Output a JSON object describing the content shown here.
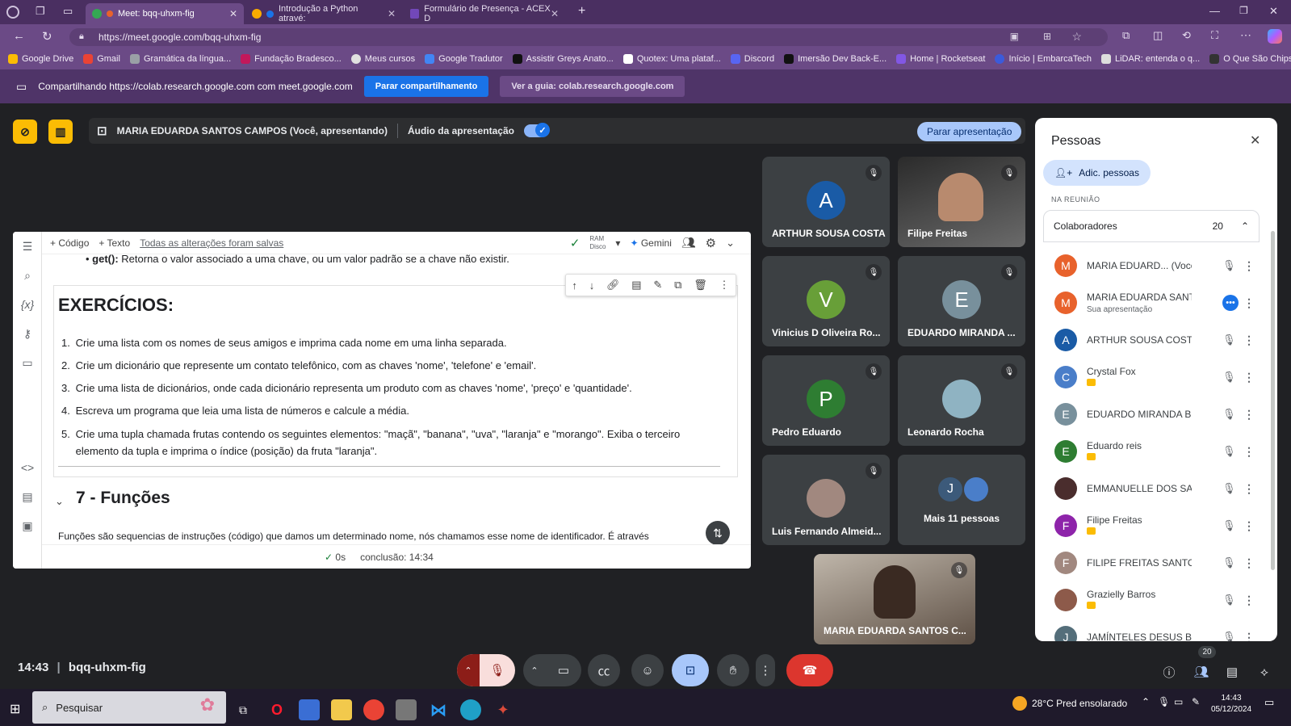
{
  "tabs": [
    {
      "title": "Meet: bqq-uhxm-fig",
      "active": true
    },
    {
      "title": "Introdução a Python atravé:",
      "active": false
    },
    {
      "title": "Formulário de Presença - ACEX D",
      "active": false
    }
  ],
  "address": {
    "url": "https://meet.google.com/bqq-uhxm-fig"
  },
  "bookmarks": [
    "Google Drive",
    "Gmail",
    "Gramática da língua...",
    "Fundação Bradesco...",
    "Meus cursos",
    "Google Tradutor",
    "Assistir Greys Anato...",
    "Quotex: Uma plataf...",
    "Discord",
    "Imersão Dev Back-E...",
    "Home | Rocketseat",
    "Início | EmbarcaTech",
    "LiDAR: entenda o q...",
    "O Que São Chips de..."
  ],
  "sharing": {
    "message": "Compartilhando https://colab.research.google.com com meet.google.com",
    "stop_label": "Parar compartilhamento",
    "view_label": "Ver a guia: colab.research.google.com"
  },
  "presentation": {
    "presenter": "MARIA EDUARDA SANTOS CAMPOS (Você, apresentando)",
    "audio_label": "Áudio da apresentação",
    "stop_label": "Parar apresentação"
  },
  "colab": {
    "add_code": "+ Código",
    "add_text": "+ Texto",
    "saved": "Todas as alterações foram salvas",
    "ram": "RAM",
    "disk": "Disco",
    "gemini": "Gemini",
    "get_bold": "get():",
    "get_text": " Retorna o valor associado a uma chave, ou um valor padrão se a chave não existir.",
    "exercises_title": "EXERCÍCIOS:",
    "exercises": [
      "Crie uma lista com os nomes de seus amigos e imprima cada nome em uma linha separada.",
      "Crie um dicionário que represente um contato telefônico, com as chaves 'nome', 'telefone' e 'email'.",
      "Crie uma lista de dicionários, onde cada dicionário representa um produto com as chaves 'nome', 'preço' e 'quantidade'.",
      "Escreva um programa que leia uma lista de números e calcule a média.",
      "Crie uma tupla chamada frutas contendo os seguintes elementos: \"maçã\", \"banana\", \"uva\", \"laranja\" e \"morango\". Exiba o terceiro elemento da tupla e imprima o índice (posição) da fruta \"laranja\"."
    ],
    "section_title": "7 - Funções",
    "cut_text": "Funções são sequencias de instruções (código) que damos um determinado nome, nós chamamos esse nome de identificador. É através",
    "status_time": "0s",
    "status_done": "conclusão: 14:34"
  },
  "tiles": [
    {
      "name": "ARTHUR SOUSA COSTA",
      "initial": "A",
      "color": "#1a5ba6"
    },
    {
      "name": "Filipe Freitas",
      "initial": "",
      "color": "#3a3a3a"
    },
    {
      "name": "Vinicius D Oliveira Ro...",
      "initial": "V",
      "color": "#689f38"
    },
    {
      "name": "EDUARDO MIRANDA ...",
      "initial": "E",
      "color": "#78909c"
    },
    {
      "name": "Pedro Eduardo",
      "initial": "P",
      "color": "#2e7d32"
    },
    {
      "name": "Leonardo Rocha",
      "initial": "",
      "color": "#6d8a96"
    },
    {
      "name": "Luis Fernando Almeid...",
      "initial": "",
      "color": "#5b4a3f"
    },
    {
      "name": "Mais 11 pessoas",
      "initial": "J",
      "color": "#3c5a7a"
    },
    {
      "name": "MARIA EDUARDA SANTOS C...",
      "initial": "",
      "color": "#6b6055"
    }
  ],
  "people": {
    "title": "Pessoas",
    "add_label": "Adic. pessoas",
    "in_meeting": "NA REUNIÃO",
    "group_label": "Colaboradores",
    "group_count": "20",
    "list": [
      {
        "name": "MARIA EDUARD...  (Você)",
        "sub": "",
        "initial": "M",
        "color": "#e8622c"
      },
      {
        "name": "MARIA EDUARDA SANT...",
        "sub": "Sua apresentação",
        "initial": "M",
        "color": "#e8622c"
      },
      {
        "name": "ARTHUR SOUSA COSTA",
        "sub": "",
        "initial": "A",
        "color": "#1a5ba6"
      },
      {
        "name": "Crystal Fox",
        "sub": "",
        "initial": "C",
        "color": "#4a7ec9"
      },
      {
        "name": "EDUARDO MIRANDA BE...",
        "sub": "",
        "initial": "E",
        "color": "#78909c"
      },
      {
        "name": "Eduardo reis",
        "sub": "",
        "initial": "E",
        "color": "#2e7d32"
      },
      {
        "name": "EMMANUELLE DOS SA...",
        "sub": "",
        "initial": "E",
        "color": "#4a2d2d"
      },
      {
        "name": "Filipe Freitas",
        "sub": "",
        "initial": "F",
        "color": "#8e24aa"
      },
      {
        "name": "FILIPE FREITAS SANTOS",
        "sub": "",
        "initial": "F",
        "color": "#a1887f"
      },
      {
        "name": "Grazielly Barros",
        "sub": "",
        "initial": "G",
        "color": "#8d5a4a"
      },
      {
        "name": "JAMÍNTELES DESUS BIB...",
        "sub": "",
        "initial": "J",
        "color": "#546e7a"
      }
    ]
  },
  "footer": {
    "time": "14:43",
    "meeting_code": "bqq-uhxm-fig",
    "people_count": "20"
  },
  "taskbar": {
    "search_placeholder": "Pesquisar",
    "weather": "28°C  Pred ensolarado",
    "time": "14:43",
    "date": "05/12/2024"
  }
}
